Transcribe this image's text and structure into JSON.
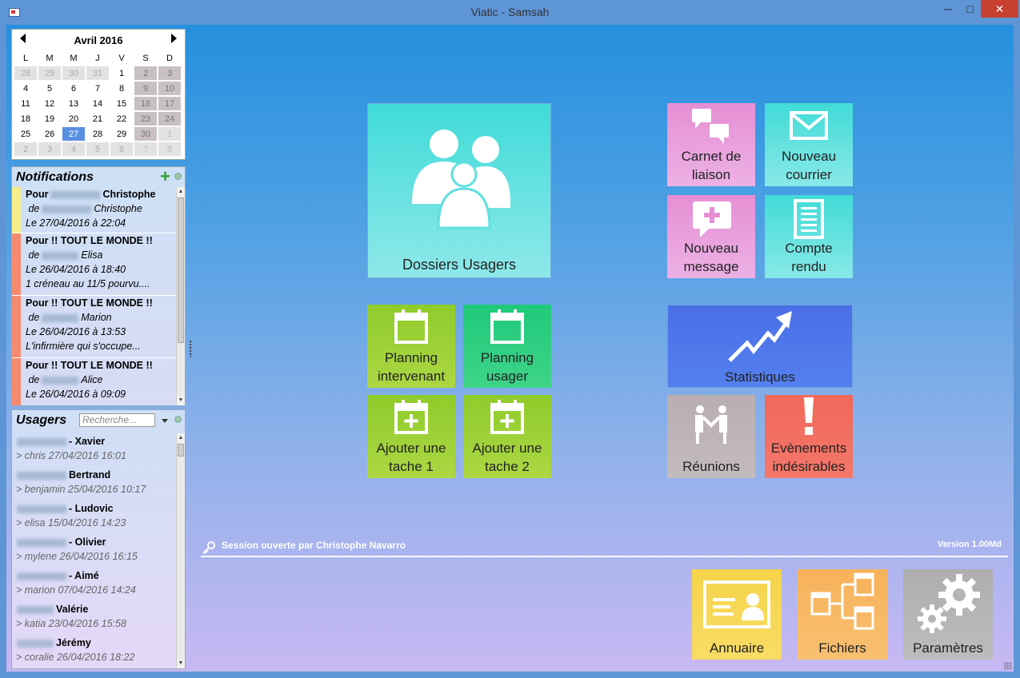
{
  "window": {
    "title": "Viatic - Samsah",
    "minimize": "─",
    "maximize": "□",
    "close": "✕"
  },
  "calendar": {
    "month_label": "Avril 2016",
    "days_of_week": [
      "L",
      "M",
      "M",
      "J",
      "V",
      "S",
      "D"
    ],
    "weeks": [
      [
        "28",
        "29",
        "30",
        "31",
        "1",
        "2",
        "3"
      ],
      [
        "4",
        "5",
        "6",
        "7",
        "8",
        "9",
        "10"
      ],
      [
        "11",
        "12",
        "13",
        "14",
        "15",
        "16",
        "17"
      ],
      [
        "18",
        "19",
        "20",
        "21",
        "22",
        "23",
        "24"
      ],
      [
        "25",
        "26",
        "27",
        "28",
        "29",
        "30",
        "1"
      ],
      [
        "2",
        "3",
        "4",
        "5",
        "6",
        "7",
        "8"
      ]
    ],
    "selected_day": "27",
    "colors": {
      "today": "#5a8fe0",
      "weekend": "#c9c1c1",
      "other_month": "#e2e2e2"
    }
  },
  "notifications": {
    "title": "Notifications",
    "add_icon": "plus-icon",
    "items": [
      {
        "line1_prefix": "Pour",
        "line1_name": "Christophe",
        "line2_prefix": "de",
        "line2_name": "Christophe",
        "line3": "Le 27/04/2016 à 22:04",
        "line4": "",
        "color": "#f7ee8a"
      },
      {
        "line1_prefix": "Pour !! TOUT LE MONDE !!",
        "line1_name": "",
        "line2_prefix": "de",
        "line2_name": "Elisa",
        "line3": "Le 26/04/2016 à 18:40",
        "line4": "1 créneau au 11/5 pourvu....",
        "color": "#f58a6e"
      },
      {
        "line1_prefix": "Pour !! TOUT LE MONDE !!",
        "line1_name": "",
        "line2_prefix": "de",
        "line2_name": "Marion",
        "line3": "Le 26/04/2016 à 13:53",
        "line4": "L'infirmière qui s'occupe...",
        "color": "#f58a6e"
      },
      {
        "line1_prefix": "Pour !! TOUT LE MONDE !!",
        "line1_name": "",
        "line2_prefix": "de",
        "line2_name": "Alice",
        "line3": "Le 26/04/2016 à 09:09",
        "line4": "",
        "color": "#f58a6e"
      }
    ]
  },
  "usagers": {
    "title": "Usagers",
    "search_placeholder": "Recherche...",
    "items": [
      {
        "name": "- Xavier",
        "sub": "> chris  27/04/2016 16:01"
      },
      {
        "name": "Bertrand",
        "sub": "> benjamin  25/04/2016 10:17"
      },
      {
        "name": "- Ludovic",
        "sub": "> elisa  15/04/2016 14:23"
      },
      {
        "name": "- Olivier",
        "sub": "> mylene  26/04/2016 16:15"
      },
      {
        "name": "- Aimé",
        "sub": "> marion  07/04/2016 14:24"
      },
      {
        "name": "Valérie",
        "sub": "> katia  23/04/2016 15:58"
      },
      {
        "name": "Jérémy",
        "sub": "> coralie  26/04/2016 18:22"
      }
    ]
  },
  "tiles": {
    "dossiers": {
      "label": "Dossiers Usagers",
      "icon": "people-icon"
    },
    "carnet": {
      "line1": "Carnet de",
      "line2": "liaison",
      "icon": "speech-bubbles-icon"
    },
    "courrier": {
      "line1": "Nouveau",
      "line2": "courrier",
      "icon": "envelope-icon"
    },
    "message": {
      "line1": "Nouveau",
      "line2": "message",
      "icon": "message-plus-icon"
    },
    "compte": {
      "line1": "Compte",
      "line2": "rendu",
      "icon": "document-icon"
    },
    "planning_intervenant": {
      "line1": "Planning",
      "line2": "intervenant",
      "icon": "calendar-icon"
    },
    "planning_usager": {
      "line1": "Planning",
      "line2": "usager",
      "icon": "calendar-icon"
    },
    "ajouter1": {
      "line1": "Ajouter une",
      "line2": "tache 1",
      "icon": "calendar-plus-icon"
    },
    "ajouter2": {
      "line1": "Ajouter une",
      "line2": "tache 2",
      "icon": "calendar-plus-icon"
    },
    "statistiques": {
      "label": "Statistiques",
      "icon": "trend-arrow-icon"
    },
    "reunions": {
      "label": "Réunions",
      "icon": "handshake-icon"
    },
    "evenements": {
      "line1": "Evènements",
      "line2": "indésirables",
      "icon": "exclamation-icon"
    },
    "annuaire": {
      "label": "Annuaire",
      "icon": "contact-card-icon"
    },
    "fichiers": {
      "label": "Fichiers",
      "icon": "file-tree-icon"
    },
    "parametres": {
      "label": "Paramètres",
      "icon": "gears-icon"
    }
  },
  "status": {
    "session": "Session ouverte par Christophe Navarro",
    "version": "Version 1.00Md",
    "key_icon": "key-icon"
  }
}
